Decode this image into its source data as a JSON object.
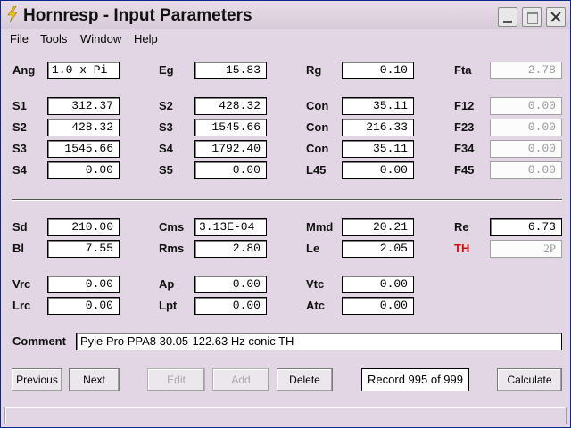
{
  "window": {
    "title": "Hornresp - Input Parameters"
  },
  "menu": [
    "File",
    "Tools",
    "Window",
    "Help"
  ],
  "params": {
    "Ang": {
      "label": "Ang",
      "value": "1.0 x Pi"
    },
    "Eg": {
      "label": "Eg",
      "value": "15.83"
    },
    "Rg": {
      "label": "Rg",
      "value": "0.10"
    },
    "Fta": {
      "label": "Fta",
      "value": "2.78"
    },
    "S1": {
      "label": "S1",
      "value": "312.37"
    },
    "S2a": {
      "label": "S2",
      "value": "428.32"
    },
    "Con1": {
      "label": "Con",
      "value": "35.11"
    },
    "F12": {
      "label": "F12",
      "value": "0.00"
    },
    "S2b": {
      "label": "S2",
      "value": "428.32"
    },
    "S3a": {
      "label": "S3",
      "value": "1545.66"
    },
    "Con2": {
      "label": "Con",
      "value": "216.33"
    },
    "F23": {
      "label": "F23",
      "value": "0.00"
    },
    "S3b": {
      "label": "S3",
      "value": "1545.66"
    },
    "S4a": {
      "label": "S4",
      "value": "1792.40"
    },
    "Con3": {
      "label": "Con",
      "value": "35.11"
    },
    "F34": {
      "label": "F34",
      "value": "0.00"
    },
    "S4b": {
      "label": "S4",
      "value": "0.00"
    },
    "S5": {
      "label": "S5",
      "value": "0.00"
    },
    "L45": {
      "label": "L45",
      "value": "0.00"
    },
    "F45": {
      "label": "F45",
      "value": "0.00"
    },
    "Sd": {
      "label": "Sd",
      "value": "210.00"
    },
    "Cms": {
      "label": "Cms",
      "value": "3.13E-04"
    },
    "Mmd": {
      "label": "Mmd",
      "value": "20.21"
    },
    "Re": {
      "label": "Re",
      "value": "6.73"
    },
    "Bl": {
      "label": "Bl",
      "value": "7.55"
    },
    "Rms": {
      "label": "Rms",
      "value": "2.80"
    },
    "Le": {
      "label": "Le",
      "value": "2.05"
    },
    "TH": {
      "label": "TH",
      "value": "2P"
    },
    "Vrc": {
      "label": "Vrc",
      "value": "0.00"
    },
    "Ap": {
      "label": "Ap",
      "value": "0.00"
    },
    "Vtc": {
      "label": "Vtc",
      "value": "0.00"
    },
    "Lrc": {
      "label": "Lrc",
      "value": "0.00"
    },
    "Lpt": {
      "label": "Lpt",
      "value": "0.00"
    },
    "Atc": {
      "label": "Atc",
      "value": "0.00"
    }
  },
  "comment": {
    "label": "Comment",
    "value": "Pyle Pro PPA8 30.05-122.63 Hz conic TH"
  },
  "buttons": {
    "previous": "Previous",
    "next": "Next",
    "edit": "Edit",
    "add": "Add",
    "delete": "Delete",
    "calculate": "Calculate"
  },
  "record": "Record 995 of 999",
  "colors": {
    "window_bg": "#e2d6e4",
    "th_label": "#d01010",
    "readonly_text": "#9a9a9a"
  }
}
